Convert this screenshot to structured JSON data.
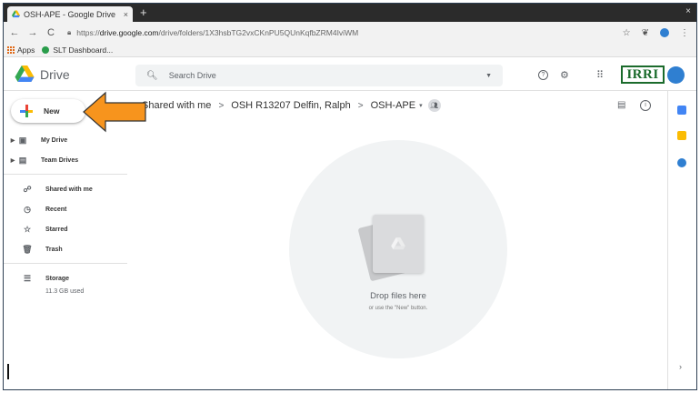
{
  "browser": {
    "tab_title": "OSH-APE - Google Drive",
    "tab_close": "×",
    "new_tab": "+",
    "window_close": "×",
    "nav_back": "←",
    "nav_forward": "→",
    "nav_reload": "C",
    "url_scheme": "https://",
    "url_domain": "drive.google.com",
    "url_path": "/drive/folders/1X3hsbTG2vxCKnPU5QUnKqfbZRM4IviWM",
    "star": "☆",
    "menu": "⋮",
    "bookmarks": [
      "Apps",
      "SLT Dashboard..."
    ]
  },
  "drive": {
    "logo_text": "Drive",
    "search_placeholder": "Search Drive",
    "help_icon": "?",
    "settings_icon": "⚙",
    "apps_icon": "⠿",
    "org_logo_text": "IRRI"
  },
  "sidebar": {
    "new_label": "New",
    "items": [
      {
        "label": "My Drive",
        "icon": "my-drive-icon"
      },
      {
        "label": "Team Drives",
        "icon": "team-drives-icon"
      },
      {
        "label": "Shared with me",
        "icon": "shared-icon"
      },
      {
        "label": "Recent",
        "icon": "recent-icon"
      },
      {
        "label": "Starred",
        "icon": "star-icon"
      },
      {
        "label": "Trash",
        "icon": "trash-icon"
      },
      {
        "label": "Storage",
        "icon": "storage-icon"
      }
    ],
    "storage_used": "11.3 GB used"
  },
  "breadcrumb": {
    "items": [
      "Shared with me",
      "OSH R13207 Delfin, Ralph",
      "OSH-APE"
    ],
    "separator": ">",
    "dropdown": "▾"
  },
  "dropzone": {
    "title": "Drop files here",
    "subtitle": "or use the \"New\" button."
  },
  "colors": {
    "accent_blue": "#2f7fd1",
    "arrow_orange": "#f7941d",
    "irri_green": "#1b6b2c"
  }
}
